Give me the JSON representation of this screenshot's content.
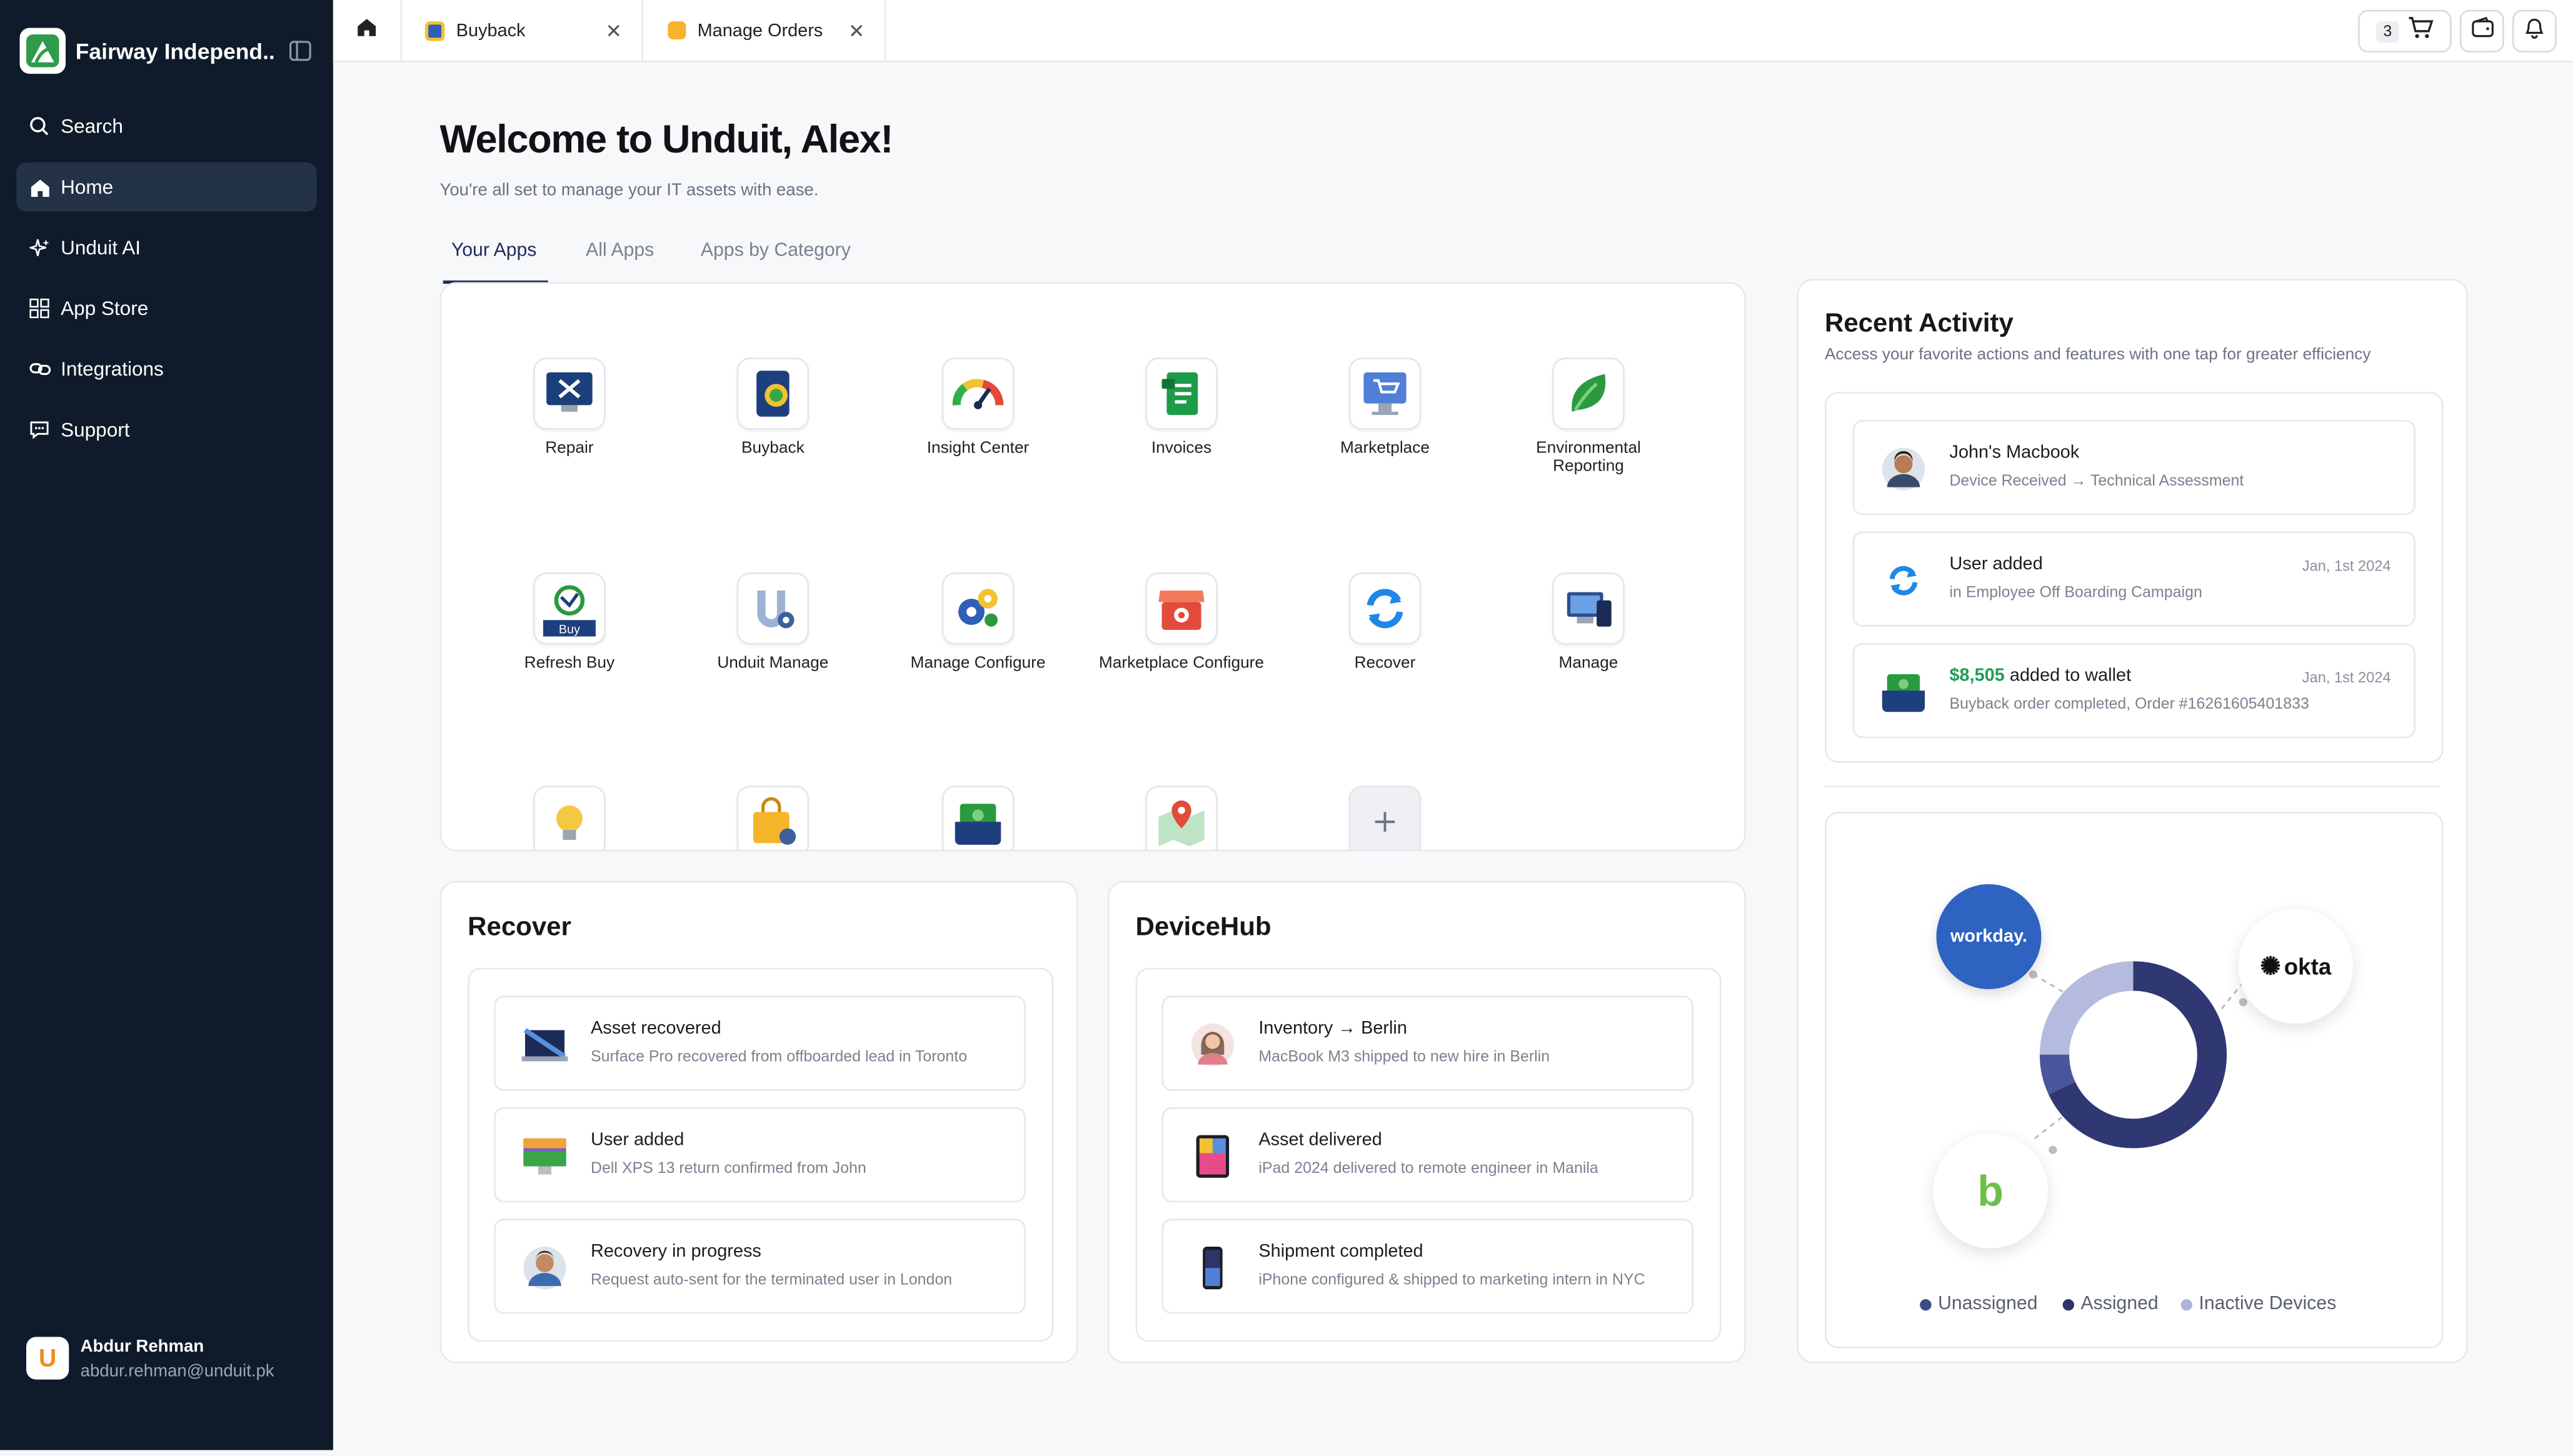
{
  "sidebar": {
    "org_name": "Fairway Independ..",
    "nav": [
      {
        "label": "Search",
        "icon": "search-icon"
      },
      {
        "label": "Home",
        "icon": "home-icon"
      },
      {
        "label": "Unduit AI",
        "icon": "sparkle-icon"
      },
      {
        "label": "App Store",
        "icon": "grid-icon"
      },
      {
        "label": "Integrations",
        "icon": "link-icon"
      },
      {
        "label": "Support",
        "icon": "chat-icon"
      }
    ],
    "active": "Home",
    "user": {
      "initial": "U",
      "name": "Abdur Rehman",
      "email": "abdur.rehman@unduit.pk"
    }
  },
  "topbar": {
    "tabs": [
      {
        "label": "Buyback",
        "icon": "buyback-icon"
      },
      {
        "label": "Manage Orders",
        "icon": "orders-icon"
      }
    ],
    "cart_count": "3"
  },
  "main": {
    "welcome": "Welcome to Unduit, Alex!",
    "subtitle": "You're all set to manage your IT assets with ease.",
    "tabs": [
      "Your Apps",
      "All Apps",
      "Apps by Category"
    ],
    "active_tab": "Your Apps",
    "apps": [
      {
        "label": "Repair"
      },
      {
        "label": "Buyback"
      },
      {
        "label": "Insight Center"
      },
      {
        "label": "Invoices"
      },
      {
        "label": "Marketplace"
      },
      {
        "label": "Environmental Reporting"
      },
      {
        "label": "Refresh Buy",
        "badge": "Buy"
      },
      {
        "label": "Unduit Manage"
      },
      {
        "label": "Manage Configure"
      },
      {
        "label": "Marketplace Configure"
      },
      {
        "label": "Recover"
      },
      {
        "label": "Manage"
      }
    ]
  },
  "recover": {
    "title": "Recover",
    "items": [
      {
        "title": "Asset recovered",
        "subtitle": "Surface Pro recovered from offboarded lead in Toronto"
      },
      {
        "title": "User added",
        "subtitle": "Dell XPS 13 return confirmed from John"
      },
      {
        "title": "Recovery in progress",
        "subtitle": "Request auto-sent for the terminated user in London"
      }
    ]
  },
  "devicehub": {
    "title": "DeviceHub",
    "items": [
      {
        "title": "Inventory → Berlin",
        "subtitle": "MacBook M3 shipped to new hire in Berlin"
      },
      {
        "title": "Asset delivered",
        "subtitle": "iPad 2024 delivered to remote engineer in Manila"
      },
      {
        "title": "Shipment completed",
        "subtitle": "iPhone configured & shipped to marketing intern in NYC"
      }
    ]
  },
  "recent": {
    "title": "Recent Activity",
    "subtitle": "Access your favorite actions and features with one tap for greater efficiency",
    "items": [
      {
        "title": "John's Macbook",
        "subtitle": "Device Received → Technical Assessment",
        "date": ""
      },
      {
        "title": "User added",
        "subtitle": "in Employee Off Boarding Campaign",
        "date": "Jan, 1st 2024"
      },
      {
        "title_amount": "$8,505",
        "title_rest": "added to wallet",
        "subtitle": "Buyback order completed, Order #16261605401833",
        "date": "Jan, 1st 2024"
      }
    ]
  },
  "donut": {
    "integrations": {
      "workday": "workday.",
      "okta": "okta",
      "bamboo": "b"
    },
    "legend": [
      {
        "label": "Unassigned",
        "color": "#3f4a86"
      },
      {
        "label": "Assigned",
        "color": "#2d3568"
      },
      {
        "label": "Inactive Devices",
        "color": "#aeb4da"
      }
    ],
    "segments": [
      {
        "label": "Assigned",
        "fraction": 0.68,
        "color": "#2f3873"
      },
      {
        "label": "Unassigned",
        "fraction": 0.07,
        "color": "#4a569b"
      },
      {
        "label": "Inactive Devices",
        "fraction": 0.25,
        "color": "#b5badf"
      }
    ]
  },
  "colors": {
    "sidebar": "#0f1b2a",
    "accent": "#1f2c5a",
    "money": "#1f9d55"
  }
}
